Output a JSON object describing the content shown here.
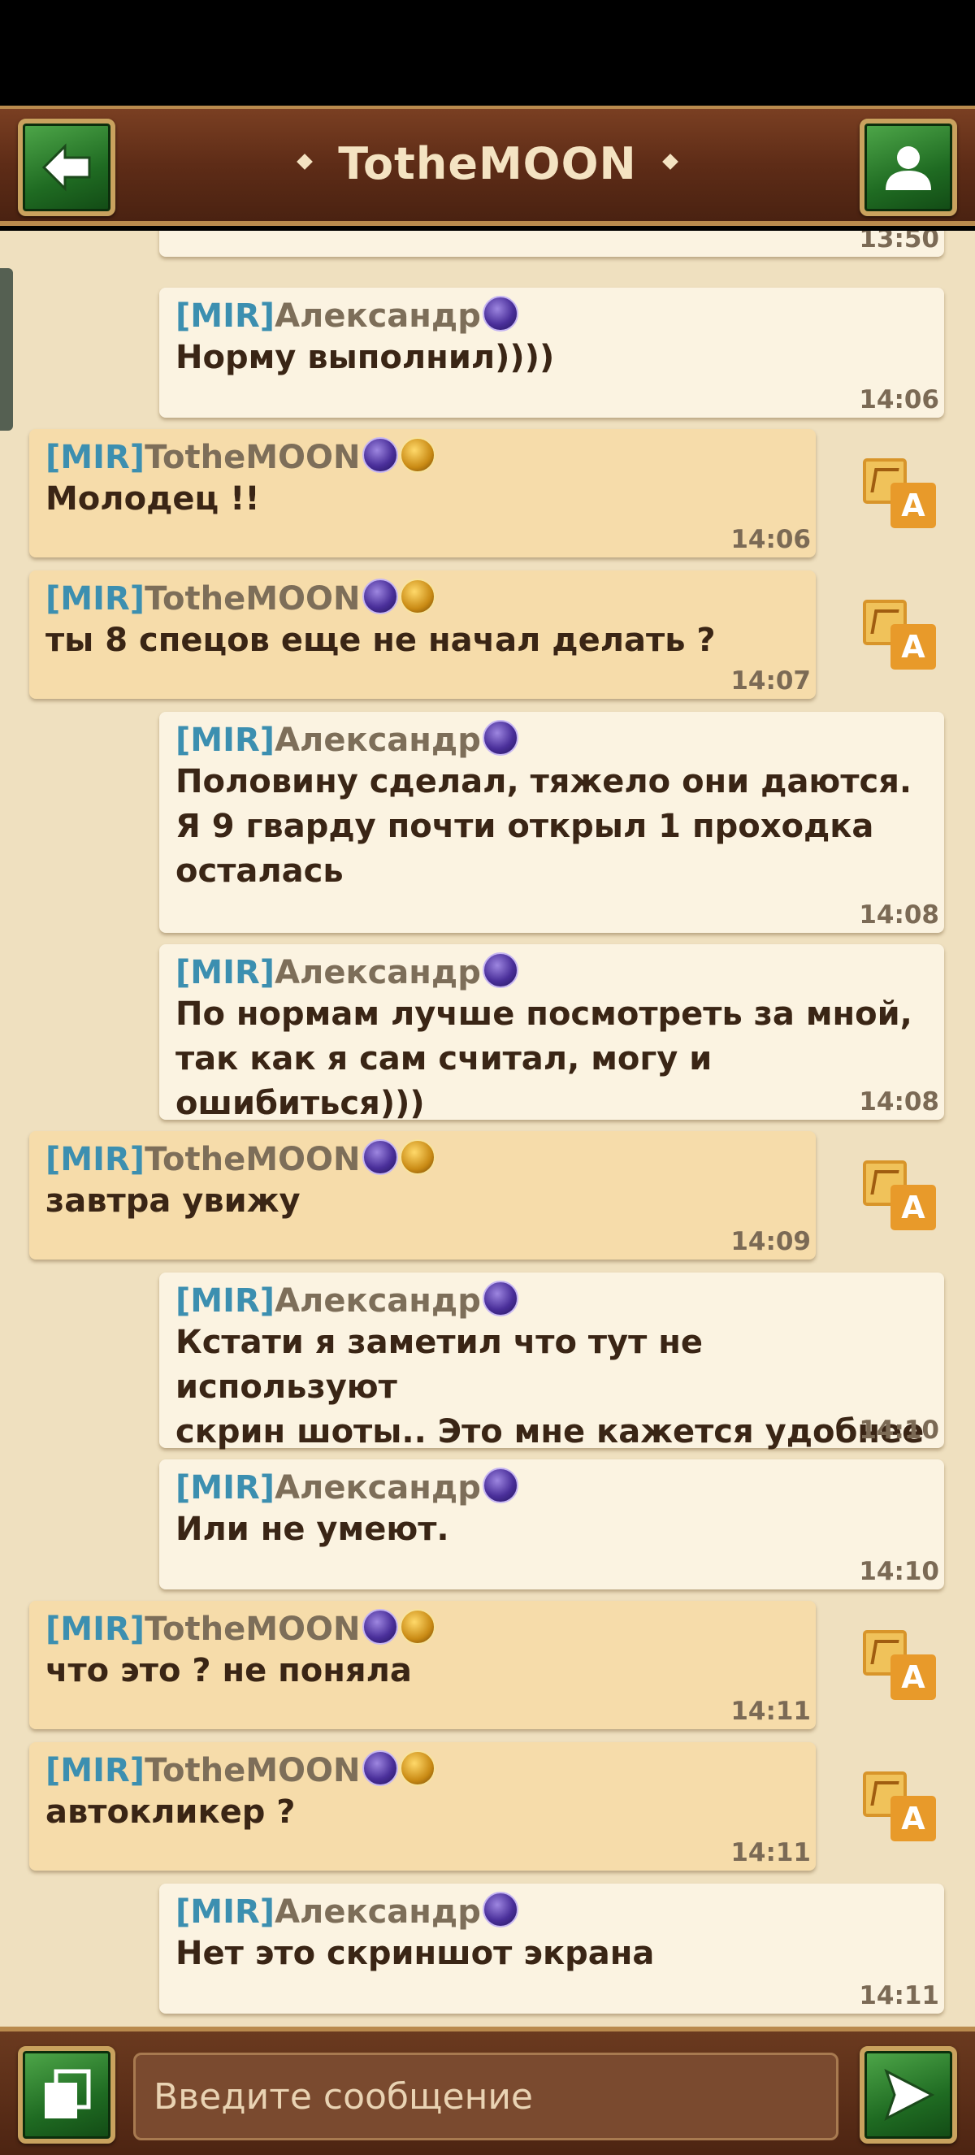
{
  "header": {
    "title": "TotheMOON"
  },
  "messages": [
    {
      "side": "mine",
      "tag": "",
      "sender": "",
      "badges": [],
      "text": "",
      "time": "13:50"
    },
    {
      "side": "mine",
      "tag": "[MIR]",
      "sender": "Александр",
      "badges": [
        "purple"
      ],
      "text": "Норму выполнил))))",
      "time": "14:06"
    },
    {
      "side": "other",
      "tag": "[MIR]",
      "sender": "TotheMOON",
      "badges": [
        "purple",
        "gold"
      ],
      "text": "Молодец !!",
      "time": "14:06"
    },
    {
      "side": "other",
      "tag": "[MIR]",
      "sender": "TotheMOON",
      "badges": [
        "purple",
        "gold"
      ],
      "text": "ты 8 спецов еще не начал делать ?",
      "time": "14:07"
    },
    {
      "side": "mine",
      "tag": "[MIR]",
      "sender": "Александр",
      "badges": [
        "purple"
      ],
      "text": "Половину сделал, тяжело они даются.\nЯ 9 гварду почти открыл 1 проходка\nосталась",
      "time": "14:08"
    },
    {
      "side": "mine",
      "tag": "[MIR]",
      "sender": "Александр",
      "badges": [
        "purple"
      ],
      "text": "По нормам лучше посмотреть за мной,\nтак как я сам считал, могу и ошибиться)))",
      "time": "14:08"
    },
    {
      "side": "other",
      "tag": "[MIR]",
      "sender": "TotheMOON",
      "badges": [
        "purple",
        "gold"
      ],
      "text": "завтра увижу",
      "time": "14:09"
    },
    {
      "side": "mine",
      "tag": "[MIR]",
      "sender": "Александр",
      "badges": [
        "purple"
      ],
      "text": "Кстати я заметил что тут не используют\nскрин шоты.. Это мне кажется удобнее",
      "time": "14:10"
    },
    {
      "side": "mine",
      "tag": "[MIR]",
      "sender": "Александр",
      "badges": [
        "purple"
      ],
      "text": "Или не умеют.",
      "time": "14:10"
    },
    {
      "side": "other",
      "tag": "[MIR]",
      "sender": "TotheMOON",
      "badges": [
        "purple",
        "gold"
      ],
      "text": "что это ? не поняла",
      "time": "14:11"
    },
    {
      "side": "other",
      "tag": "[MIR]",
      "sender": "TotheMOON",
      "badges": [
        "purple",
        "gold"
      ],
      "text": "автокликер ?",
      "time": "14:11"
    },
    {
      "side": "mine",
      "tag": "[MIR]",
      "sender": "Александр",
      "badges": [
        "purple"
      ],
      "text": "Нет это скриншот экрана",
      "time": "14:11"
    }
  ],
  "translate_icon_letter": "A",
  "footer": {
    "input_placeholder": "Введите сообщение"
  },
  "colors": {
    "header_brown": "#5e2c17",
    "button_green": "#1f6b22",
    "chat_bg": "#efe0bf",
    "mine_bubble": "#fbf3e1",
    "other_bubble": "#f6dcaa",
    "tag_blue": "#3c8fb0"
  }
}
